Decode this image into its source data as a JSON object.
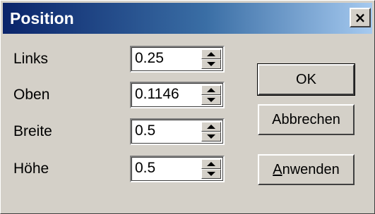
{
  "window": {
    "title": "Position",
    "close_symbol": "×"
  },
  "fields": [
    {
      "label": "Links",
      "value": "0.25"
    },
    {
      "label": "Oben",
      "value": "0.1146"
    },
    {
      "label": "Breite",
      "value": "0.5"
    },
    {
      "label": "Höhe",
      "value": "0.5"
    }
  ],
  "buttons": {
    "ok": "OK",
    "cancel": "Abbrechen",
    "apply_mnemonic": "A",
    "apply_rest": "nwenden"
  },
  "icons": {
    "close": "close-icon",
    "spin_up": "spin-up-icon",
    "spin_down": "spin-down-icon"
  }
}
